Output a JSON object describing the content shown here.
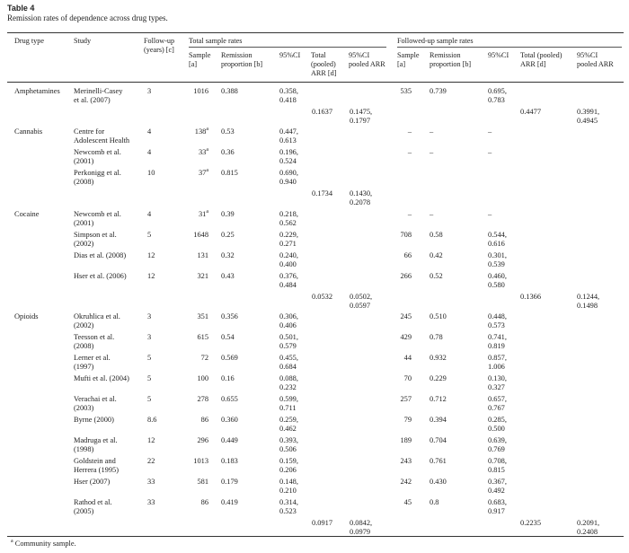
{
  "title": "Table 4",
  "caption": "Remission rates of dependence across drug types.",
  "header": {
    "drug_type": "Drug type",
    "study": "Study",
    "follow_up": "Follow-up\n(years) [c]",
    "total_group": "Total sample rates",
    "followed_group": "Followed-up sample rates",
    "sample": "Sample\n[a]",
    "remission": "Remission\nproportion [b]",
    "ci": "95%CI",
    "total_pooled": "Total\n(pooled)\nARR [d]",
    "ci_pooled": "95%CI\npooled ARR",
    "sample_f": "Sample\n[a]",
    "remission_f": "Remission\nproportion [b]",
    "ci_f": "95%CI",
    "total_pooled_f": "Total (pooled)\nARR [d]",
    "ci_pooled_f": "95%CI\npooled ARR"
  },
  "rows": [
    {
      "drug": "Amphetamines",
      "study": "Merinelli-Casey\net al. (2007)",
      "fu": "3",
      "n": "1016",
      "sup": "",
      "p": "0.388",
      "ci": "0.358,\n0.418",
      "fn": "535",
      "fp": "0.739",
      "fci": "0.695,\n0.783"
    },
    {
      "drug": "Cannabis",
      "study": "Centre for\nAdolescent Health",
      "fu": "4",
      "n": "138",
      "sup": "a",
      "p": "0.53",
      "ci": "0.447,\n0.613",
      "fn": "–",
      "fp": "–",
      "fci": "–"
    },
    {
      "drug": "",
      "study": "Newcomb et al.\n(2001)",
      "fu": "4",
      "n": "33",
      "sup": "a",
      "p": "0.36",
      "ci": "0.196,\n0.524",
      "fn": "–",
      "fp": "–",
      "fci": "–"
    },
    {
      "drug": "",
      "study": "Perkonigg et al.\n(2008)",
      "fu": "10",
      "n": "37",
      "sup": "a",
      "p": "0.815",
      "ci": "0.690,\n0.940",
      "fn": "",
      "fp": "",
      "fci": ""
    },
    {
      "drug": "Cocaine",
      "study": "Newcomb et al.\n(2001)",
      "fu": "4",
      "n": "31",
      "sup": "a",
      "p": "0.39",
      "ci": "0.218,\n0.562",
      "fn": "–",
      "fp": "–",
      "fci": "–"
    },
    {
      "drug": "",
      "study": "Simpson et al.\n(2002)",
      "fu": "5",
      "n": "1648",
      "sup": "",
      "p": "0.25",
      "ci": "0.229,\n0.271",
      "fn": "708",
      "fp": "0.58",
      "fci": "0.544,\n0.616"
    },
    {
      "drug": "",
      "study": "Dias et al. (2008)",
      "fu": "12",
      "n": "131",
      "sup": "",
      "p": "0.32",
      "ci": "0.240,\n0.400",
      "fn": "66",
      "fp": "0.42",
      "fci": "0.301,\n0.539"
    },
    {
      "drug": "",
      "study": "Hser et al. (2006)",
      "fu": "12",
      "n": "321",
      "sup": "",
      "p": "0.43",
      "ci": "0.376,\n0.484",
      "fn": "266",
      "fp": "0.52",
      "fci": "0.460,\n0.580"
    },
    {
      "drug": "Opioids",
      "study": "Okruhlica et al.\n(2002)",
      "fu": "3",
      "n": "351",
      "sup": "",
      "p": "0.356",
      "ci": "0.306,\n0.406",
      "fn": "245",
      "fp": "0.510",
      "fci": "0.448,\n0.573"
    },
    {
      "drug": "",
      "study": "Teesson et al.\n(2008)",
      "fu": "3",
      "n": "615",
      "sup": "",
      "p": "0.54",
      "ci": "0.501,\n0.579",
      "fn": "429",
      "fp": "0.78",
      "fci": "0.741,\n0.819"
    },
    {
      "drug": "",
      "study": "Lerner et al.\n(1997)",
      "fu": "5",
      "n": "72",
      "sup": "",
      "p": "0.569",
      "ci": "0.455,\n0.684",
      "fn": "44",
      "fp": "0.932",
      "fci": "0.857,\n1.006"
    },
    {
      "drug": "",
      "study": "Mufti et al. (2004)",
      "fu": "5",
      "n": "100",
      "sup": "",
      "p": "0.16",
      "ci": "0.088,\n0.232",
      "fn": "70",
      "fp": "0.229",
      "fci": "0.130,\n0.327"
    },
    {
      "drug": "",
      "study": "Verachai et al.\n(2003)",
      "fu": "5",
      "n": "278",
      "sup": "",
      "p": "0.655",
      "ci": "0.599,\n0.711",
      "fn": "257",
      "fp": "0.712",
      "fci": "0.657,\n0.767"
    },
    {
      "drug": "",
      "study": "Byrne (2000)",
      "fu": "8.6",
      "n": "86",
      "sup": "",
      "p": "0.360",
      "ci": "0.259,\n0.462",
      "fn": "79",
      "fp": "0.394",
      "fci": "0.285,\n0.500"
    },
    {
      "drug": "",
      "study": "Madruga et al.\n(1998)",
      "fu": "12",
      "n": "296",
      "sup": "",
      "p": "0.449",
      "ci": "0.393,\n0.506",
      "fn": "189",
      "fp": "0.704",
      "fci": "0.639,\n0.769"
    },
    {
      "drug": "",
      "study": "Goldstein and\nHerrera (1995)",
      "fu": "22",
      "n": "1013",
      "sup": "",
      "p": "0.183",
      "ci": "0.159,\n0.206",
      "fn": "243",
      "fp": "0.761",
      "fci": "0.708,\n0.815"
    },
    {
      "drug": "",
      "study": "Hser (2007)",
      "fu": "33",
      "n": "581",
      "sup": "",
      "p": "0.179",
      "ci": "0.148,\n0.210",
      "fn": "242",
      "fp": "0.430",
      "fci": "0.367,\n0.492"
    },
    {
      "drug": "",
      "study": "Rathod et al.\n(2005)",
      "fu": "33",
      "n": "86",
      "sup": "",
      "p": "0.419",
      "ci": "0.314,\n0.523",
      "fn": "45",
      "fp": "0.8",
      "fci": "0.683,\n0.917"
    }
  ],
  "pooled": [
    {
      "arr": "0.1637",
      "ci": "0.1475,\n0.1797",
      "farr": "0.4477",
      "fci": "0.3991,\n0.4945"
    },
    {
      "arr": "0.1734",
      "ci": "0.1430,\n0.2078",
      "farr": "",
      "fci": ""
    },
    {
      "arr": "0.0532",
      "ci": "0.0502,\n0.0597",
      "farr": "0.1366",
      "fci": "0.1244,\n0.1498"
    },
    {
      "arr": "0.0917",
      "ci": "0.0842,\n0.0979",
      "farr": "0.2235",
      "fci": "0.2091,\n0.2408"
    }
  ],
  "footnote_mark": "a",
  "footnote": "Community sample."
}
